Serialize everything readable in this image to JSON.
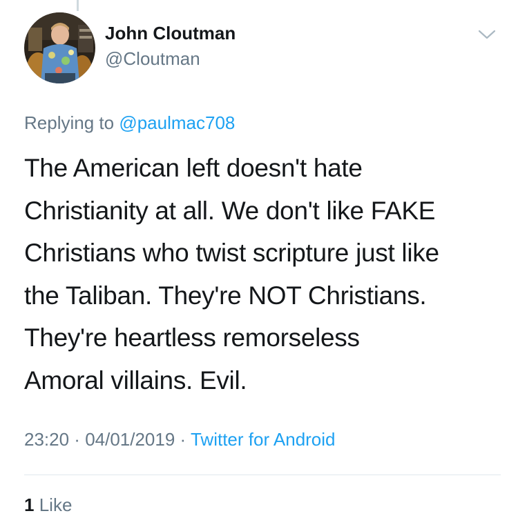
{
  "tweet": {
    "author": {
      "name": "John Cloutman",
      "handle": "@Cloutman"
    },
    "reply": {
      "prefix": "Replying to ",
      "mention": "@paulmac708"
    },
    "text_lines": [
      "The American left doesn't hate",
      "Christianity at all. We don't like FAKE",
      "Christians who twist scripture just like",
      "the Taliban. They're NOT Christians.",
      "They're heartless remorseless",
      "Amoral villains. Evil."
    ],
    "time": "23:20",
    "date": "04/01/2019",
    "separator": " · ",
    "source": "Twitter for Android",
    "likes": {
      "count": "1",
      "label": "Like"
    }
  },
  "icons": {
    "menu": "chevron-down-icon",
    "avatar": "avatar-photo"
  },
  "colors": {
    "link": "#1da1f2",
    "secondary_text": "#657786",
    "primary_text": "#14171a",
    "divider": "#e1e8ed"
  }
}
